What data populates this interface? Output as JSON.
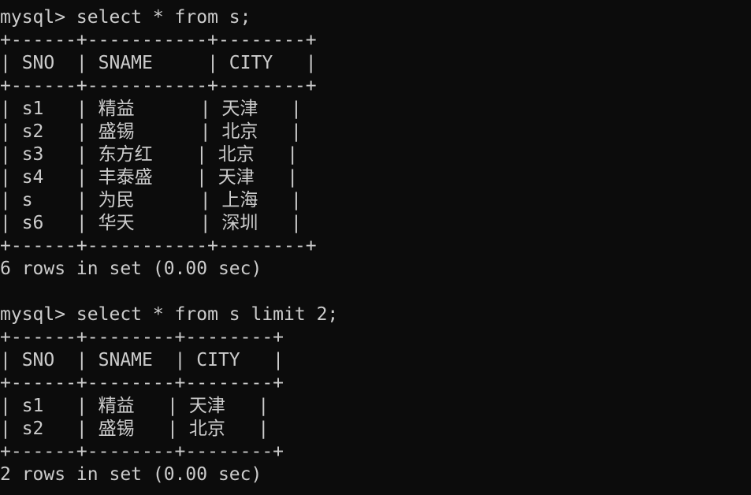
{
  "terminal": {
    "query1": {
      "command": "mysql> select * from s;",
      "sep": "+------+-----------+--------+",
      "header": "| SNO  | SNAME     | CITY   |",
      "rows": [
        "| s1   | 精益      | 天津   |",
        "| s2   | 盛锡      | 北京   |",
        "| s3   | 东方红    | 北京   |",
        "| s4   | 丰泰盛    | 天津   |",
        "| s    | 为民      | 上海   |",
        "| s6   | 华天      | 深圳   |"
      ],
      "summary": "6 rows in set (0.00 sec)"
    },
    "query2": {
      "command": "mysql> select * from s limit 2;",
      "sep": "+------+--------+--------+",
      "header": "| SNO  | SNAME  | CITY   |",
      "rows": [
        "| s1   | 精益   | 天津   |",
        "| s2   | 盛锡   | 北京   |"
      ],
      "summary": "2 rows in set (0.00 sec)"
    }
  }
}
